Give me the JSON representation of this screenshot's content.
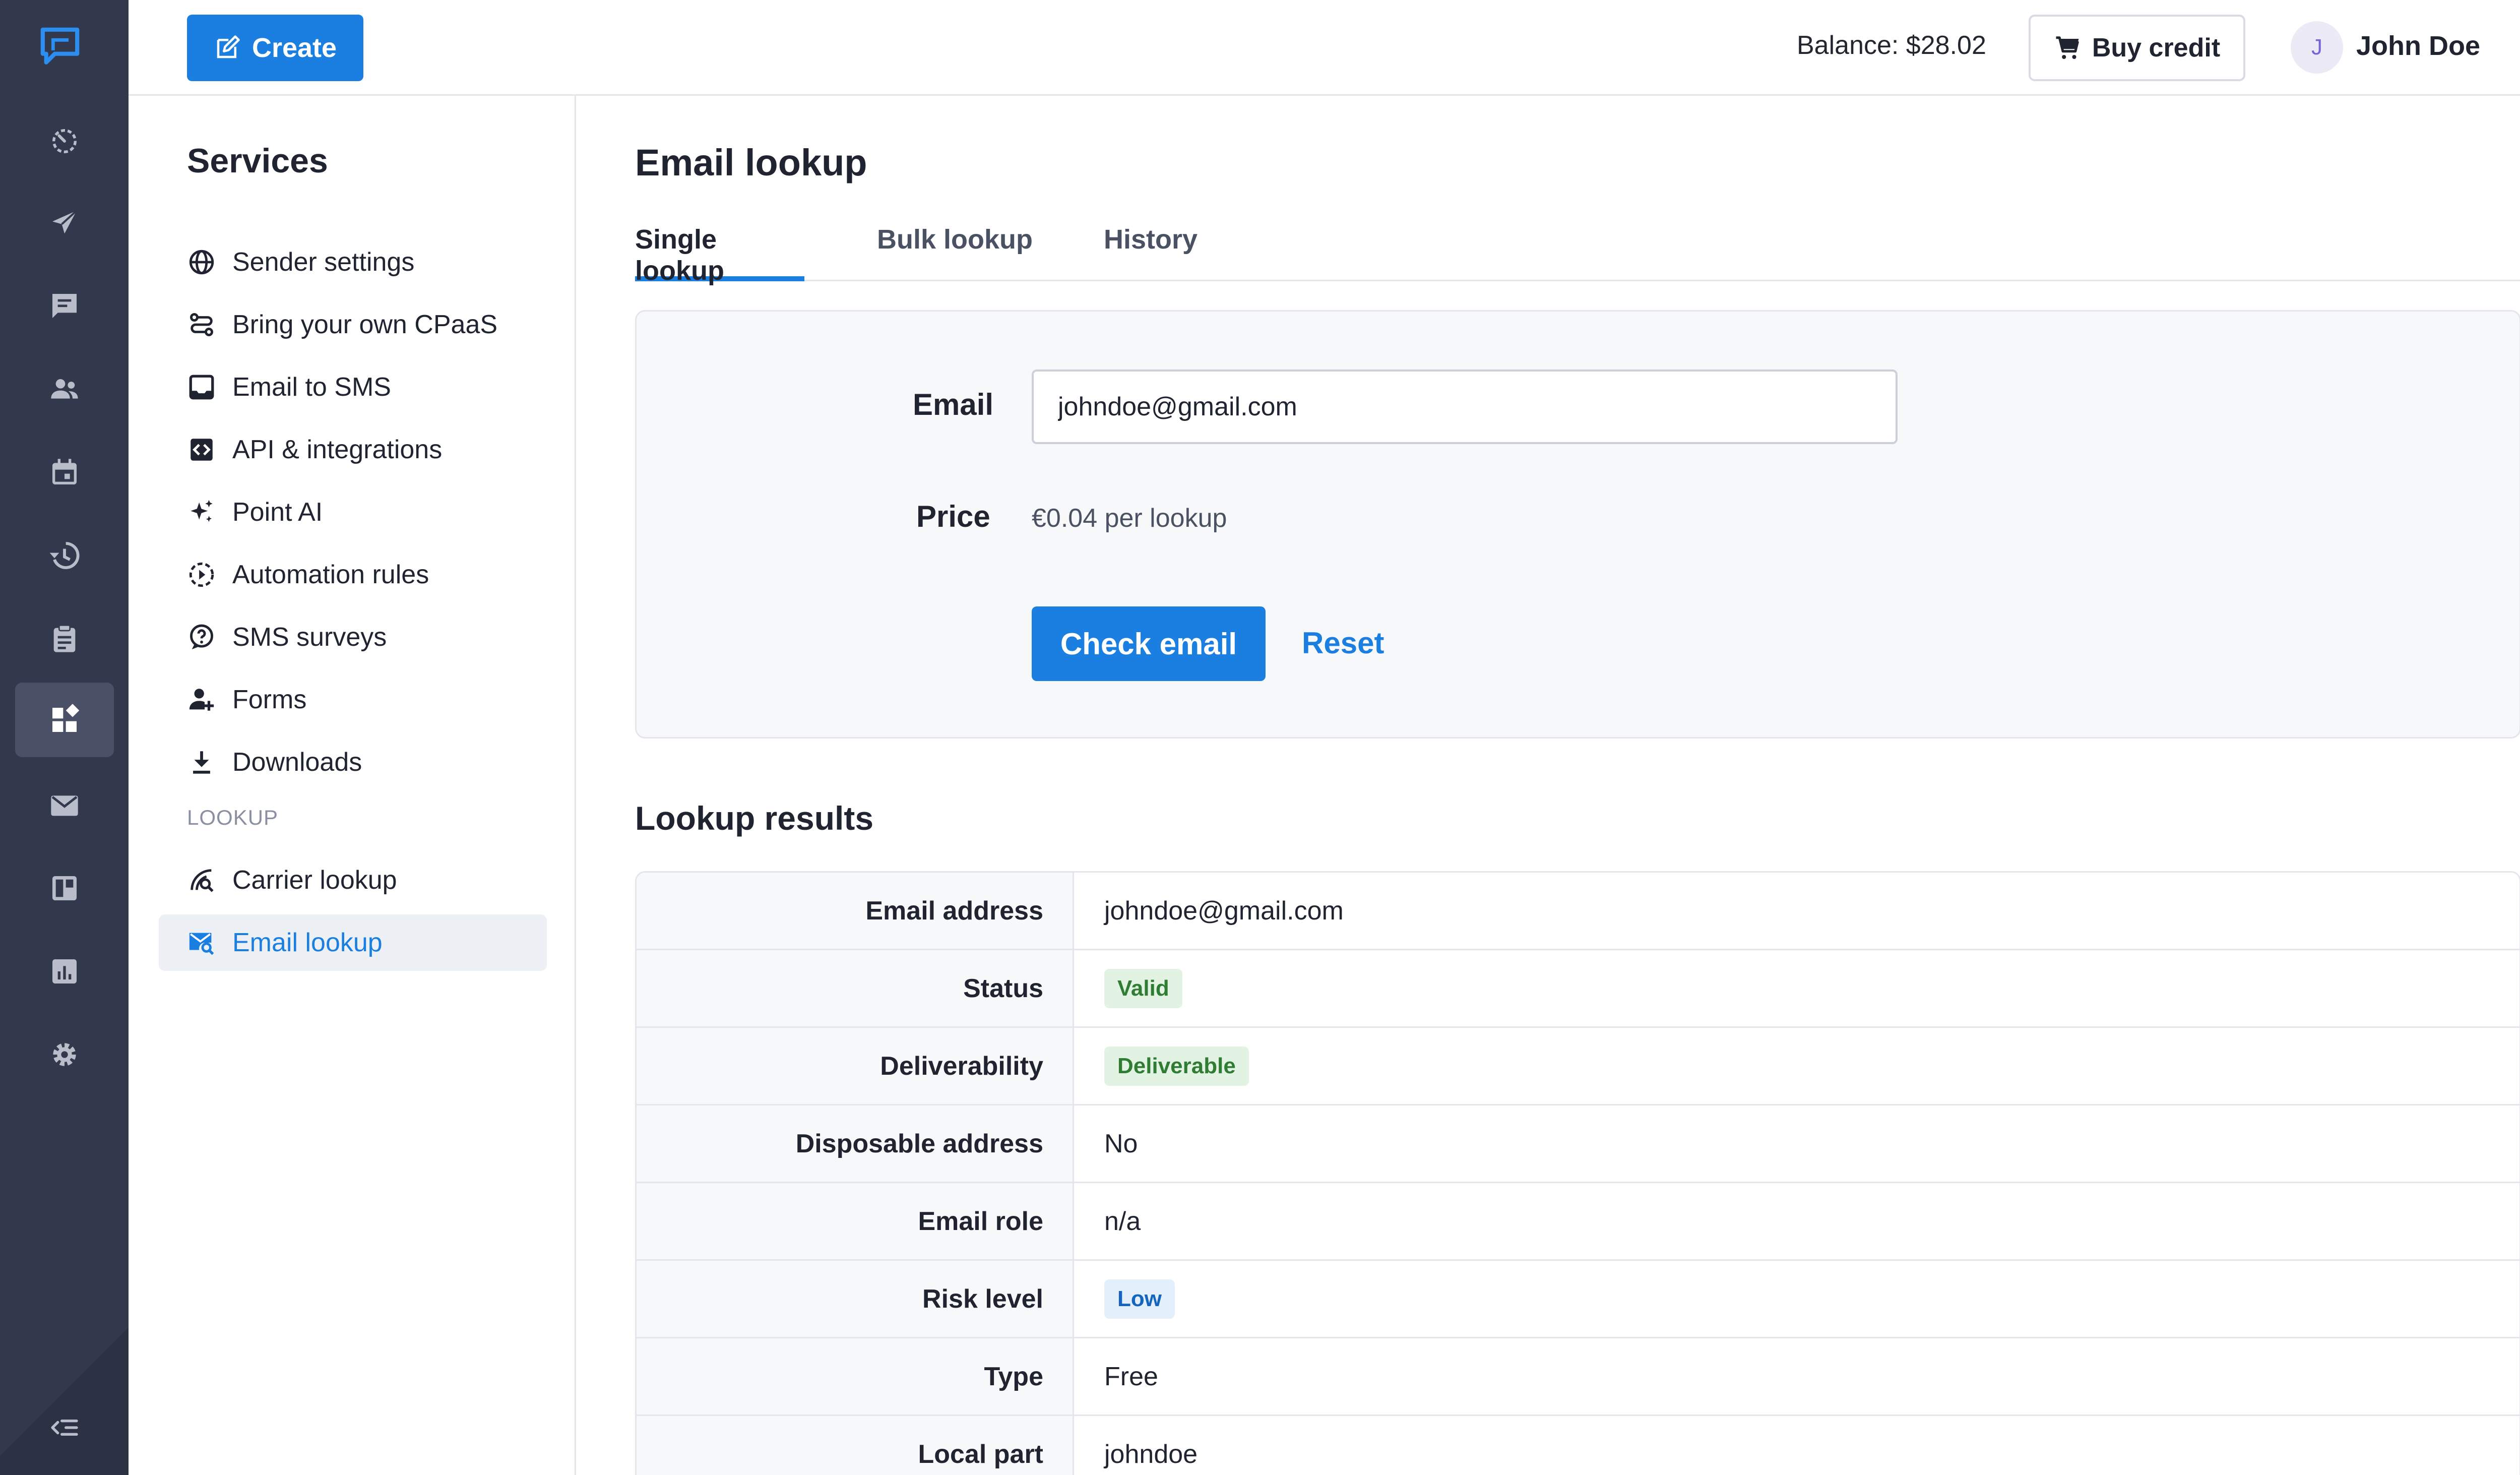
{
  "header": {
    "create_label": "Create",
    "balance": "Balance: $28.02",
    "buy_credit_label": "Buy credit",
    "user_initial": "J",
    "user_name": "John Doe"
  },
  "sidebar": {
    "title": "Services",
    "items": [
      {
        "label": "Sender settings",
        "icon": "globe-icon"
      },
      {
        "label": "Bring your own CPaaS",
        "icon": "route-icon"
      },
      {
        "label": "Email to SMS",
        "icon": "inbox-icon"
      },
      {
        "label": "API & integrations",
        "icon": "code-icon"
      },
      {
        "label": "Point AI",
        "icon": "sparkle-icon"
      },
      {
        "label": "Automation rules",
        "icon": "automation-icon"
      },
      {
        "label": "SMS surveys",
        "icon": "survey-icon"
      },
      {
        "label": "Forms",
        "icon": "person-add-icon"
      },
      {
        "label": "Downloads",
        "icon": "download-icon"
      }
    ],
    "section_label": "LOOKUP",
    "lookup_items": [
      {
        "label": "Carrier lookup",
        "icon": "carrier-icon",
        "active": false
      },
      {
        "label": "Email lookup",
        "icon": "email-search-icon",
        "active": true
      }
    ]
  },
  "main": {
    "title": "Email lookup",
    "tabs": [
      {
        "label": "Single lookup",
        "active": true
      },
      {
        "label": "Bulk lookup",
        "active": false
      },
      {
        "label": "History",
        "active": false
      }
    ],
    "form": {
      "email_label": "Email",
      "email_value": "johndoe@gmail.com",
      "price_label": "Price",
      "price_value": "€0.04 per lookup",
      "check_label": "Check email",
      "reset_label": "Reset"
    },
    "results": {
      "title": "Lookup results",
      "rows": [
        {
          "key": "Email address",
          "value": "johndoe@gmail.com"
        },
        {
          "key": "Status",
          "value": "Valid",
          "badge": "green"
        },
        {
          "key": "Deliverability",
          "value": "Deliverable",
          "badge": "green"
        },
        {
          "key": "Disposable address",
          "value": "No"
        },
        {
          "key": "Email role",
          "value": "n/a"
        },
        {
          "key": "Risk level",
          "value": "Low",
          "badge": "blue"
        },
        {
          "key": "Type",
          "value": "Free"
        },
        {
          "key": "Local part",
          "value": "johndoe"
        }
      ]
    }
  },
  "colors": {
    "accent": "#1a7fe0",
    "rail": "#33394d",
    "badge_green": "#2e7d32",
    "badge_blue": "#1565c0"
  }
}
